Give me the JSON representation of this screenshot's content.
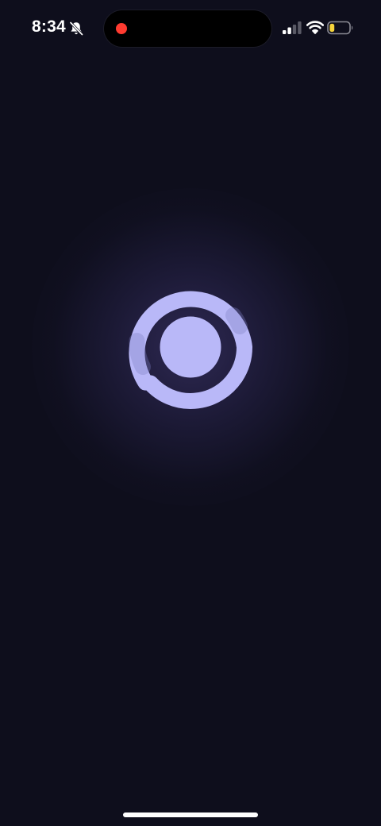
{
  "status_bar": {
    "time": "8:34",
    "silent_icon": "bell-slash-icon",
    "signal_icon": "cellular-signal-icon",
    "signal_bars_active": 2,
    "signal_bars_total": 4,
    "wifi_icon": "wifi-icon",
    "battery_icon": "battery-icon",
    "battery_level": 0.25
  },
  "dynamic_island": {
    "recording_indicator_icon": "record-dot-icon"
  },
  "splash": {
    "logo_icon": "ring-logo-icon"
  },
  "colors": {
    "background": "#0e0e1c",
    "logo": "#b9b8f8",
    "glow": "#3a3470",
    "recording": "#ff3b30",
    "battery_fill": "#f5d33b",
    "status_text": "#ffffff"
  }
}
